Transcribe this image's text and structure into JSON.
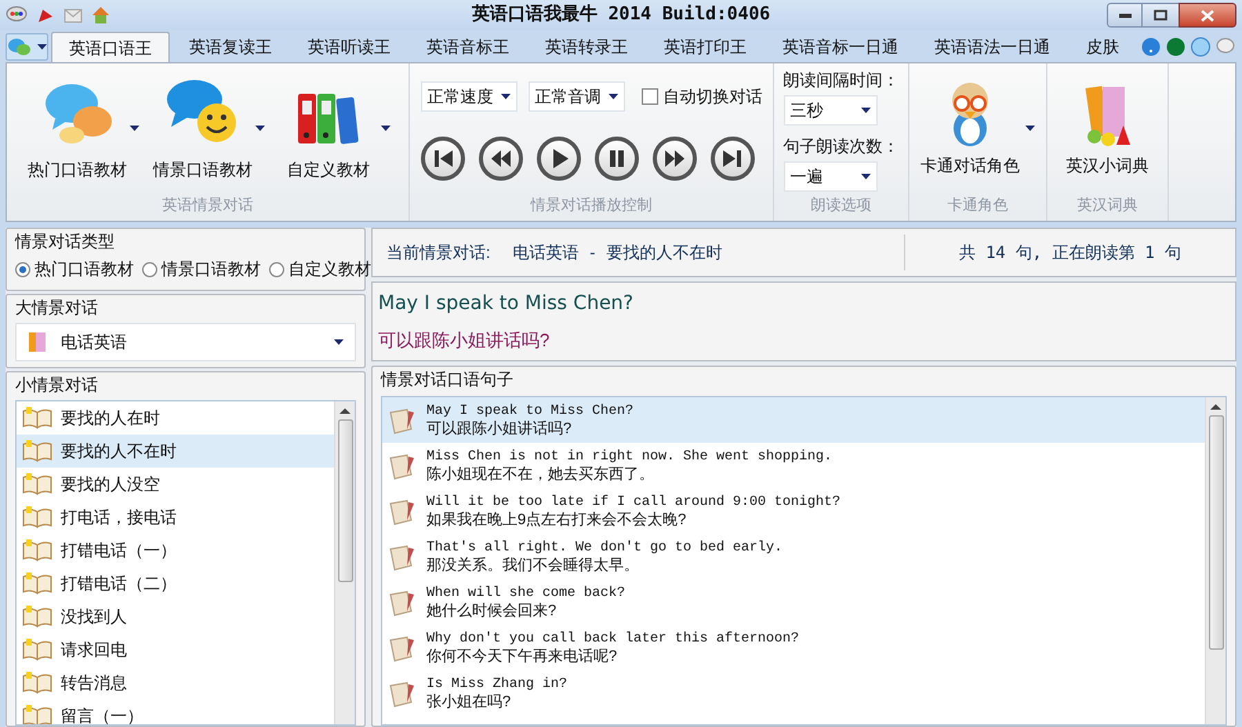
{
  "window": {
    "title": "英语口语我最牛 2014 Build:0406"
  },
  "tabs": [
    {
      "label": "英语口语王",
      "selected": true
    },
    {
      "label": "英语复读王",
      "selected": false
    },
    {
      "label": "英语听读王",
      "selected": false
    },
    {
      "label": "英语音标王",
      "selected": false
    },
    {
      "label": "英语转录王",
      "selected": false
    },
    {
      "label": "英语打印王",
      "selected": false
    },
    {
      "label": "英语音标一日通",
      "selected": false
    },
    {
      "label": "英语语法一日通",
      "selected": false
    },
    {
      "label": "皮肤",
      "selected": false
    }
  ],
  "ribbon": {
    "materials": {
      "caption": "英语情景对话",
      "buttons": [
        {
          "label": "热门口语教材",
          "kind": "bubbles"
        },
        {
          "label": "情景口语教材",
          "kind": "smiley"
        },
        {
          "label": "自定义教材",
          "kind": "binders"
        }
      ]
    },
    "playback": {
      "caption": "情景对话播放控制",
      "speed": "正常速度",
      "pitch": "正常音调",
      "auto_switch": {
        "label": "自动切换对话",
        "checked": false
      }
    },
    "reading": {
      "caption": "朗读选项",
      "interval_label": "朗读间隔时间：",
      "interval": "三秒",
      "count_label": "句子朗读次数：",
      "count": "一遍"
    },
    "cartoon": {
      "caption": "卡通角色",
      "label": "卡通对话角色"
    },
    "dictionary": {
      "caption": "英汉词典",
      "label": "英汉小词典"
    }
  },
  "dialog_type": {
    "title": "情景对话类型",
    "options": [
      {
        "label": "热门口语教材",
        "selected": true
      },
      {
        "label": "情景口语教材",
        "selected": false
      },
      {
        "label": "自定义教材",
        "selected": false
      }
    ]
  },
  "big_scene": {
    "title": "大情景对话",
    "value": "电话英语"
  },
  "small_scene": {
    "title": "小情景对话",
    "items": [
      {
        "label": "要找的人在时",
        "selected": false
      },
      {
        "label": "要找的人不在时",
        "selected": true
      },
      {
        "label": "要找的人没空",
        "selected": false
      },
      {
        "label": "打电话，接电话",
        "selected": false
      },
      {
        "label": "打错电话（一）",
        "selected": false
      },
      {
        "label": "打错电话（二）",
        "selected": false
      },
      {
        "label": "没找到人",
        "selected": false
      },
      {
        "label": "请求回电",
        "selected": false
      },
      {
        "label": "转告消息",
        "selected": false
      },
      {
        "label": "留言（一）",
        "selected": false
      }
    ]
  },
  "current": {
    "label": "当前情景对话:",
    "category": "电话英语",
    "separator": "-",
    "scene": "要找的人不在时",
    "progress": "共 14 句, 正在朗读第 1 句"
  },
  "display": {
    "english": "May I speak to Miss Chen?",
    "chinese": "可以跟陈小姐讲话吗?"
  },
  "sentences": {
    "title": "情景对话口语句子",
    "items": [
      {
        "english": "May I speak to Miss Chen?",
        "chinese": "可以跟陈小姐讲话吗?",
        "selected": true
      },
      {
        "english": "Miss Chen is not in right now. She went shopping.",
        "chinese": "陈小姐现在不在，她去买东西了。",
        "selected": false
      },
      {
        "english": "Will it be too late if I call around 9:00 tonight?",
        "chinese": "如果我在晚上9点左右打来会不会太晚?",
        "selected": false
      },
      {
        "english": "That's all right. We don't go to bed early.",
        "chinese": "那没关系。我们不会睡得太早。",
        "selected": false
      },
      {
        "english": "When will she come back?",
        "chinese": "她什么时候会回来?",
        "selected": false
      },
      {
        "english": "Why don't you call back later this afternoon?",
        "chinese": "你何不今天下午再来电话呢?",
        "selected": false
      },
      {
        "english": "Is Miss Zhang in?",
        "chinese": "张小姐在吗?",
        "selected": false
      }
    ]
  }
}
